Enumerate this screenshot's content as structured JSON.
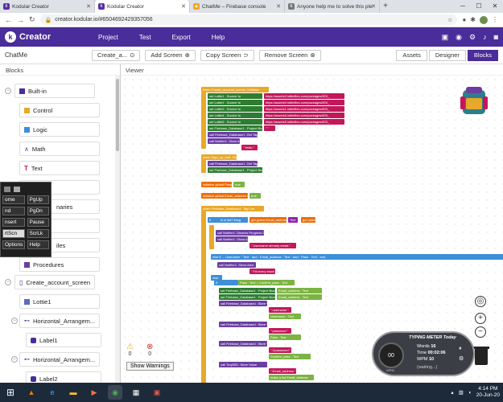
{
  "browser": {
    "tabs": [
      {
        "title": "Kodular Creator",
        "icon": "kodular-favicon",
        "active": false
      },
      {
        "title": "Kodular Creator",
        "icon": "kodular-favicon",
        "active": true
      },
      {
        "title": "ChatMe – Firebase console",
        "icon": "firebase-favicon",
        "active": false
      },
      {
        "title": "Anyone help me to solve this ple",
        "icon": "forum-favicon",
        "active": false
      }
    ],
    "url": "creator.kodular.io/#6504692429357056"
  },
  "app": {
    "logo_text": "Creator",
    "menu": [
      "Project",
      "Test",
      "Export",
      "Help"
    ]
  },
  "toolbar": {
    "project_name": "ChatMe",
    "screen_select": "Create_a...",
    "add_screen": "Add Screen",
    "copy_screen": "Copy Screen",
    "remove_screen": "Remove Screen",
    "modes": [
      "Assets",
      "Designer",
      "Blocks"
    ],
    "active_mode": "Blocks"
  },
  "blocks_panel": {
    "title": "Blocks",
    "builtin_label": "Built-in",
    "builtin": [
      {
        "label": "Control",
        "icon": "control-icon",
        "color": "#e8a82a"
      },
      {
        "label": "Logic",
        "icon": "logic-icon",
        "color": "#3e8fd8"
      },
      {
        "label": "Math",
        "icon": "math-icon",
        "color": "#3f51b5"
      },
      {
        "label": "Text",
        "icon": "text-icon",
        "color": "#c2185b"
      }
    ],
    "partial_items": [
      "naries",
      "iles"
    ],
    "procedures_label": "Procedures",
    "screen_label": "Create_account_screen",
    "components": [
      {
        "label": "Lottie1",
        "indent": 2
      },
      {
        "label": "Horizontal_Arrangem...",
        "indent": 1
      },
      {
        "label": "Label1",
        "indent": 2
      },
      {
        "label": "Horizontal_Arrangem...",
        "indent": 1
      },
      {
        "label": "Label2",
        "indent": 2
      }
    ]
  },
  "viewer": {
    "title": "Viewer",
    "warnings_count": "0",
    "errors_count": "0",
    "show_warnings": "Show Warnings"
  },
  "keyboard": {
    "rows": [
      [
        "Home",
        "PgUp"
      ],
      [
        "End",
        "PgDn"
      ],
      [
        "Insert",
        "Pause"
      ],
      [
        "PrtScn",
        "ScrLk"
      ],
      [
        "Options",
        "Help"
      ]
    ],
    "partial_rows": [
      [
        "ome",
        "PgUp"
      ],
      [
        "nd",
        "PgDn"
      ],
      [
        "nsert",
        "Pause"
      ],
      [
        "rtScn",
        "ScrLk"
      ],
      [
        "Options",
        "Help"
      ]
    ]
  },
  "typing_meter": {
    "title": "TYPING METER Today",
    "words_label": "Words",
    "words": "16",
    "time_label": "Time",
    "time": "00:02:06",
    "wpm_label": "WPM",
    "wpm": "10",
    "status": "(waiting...)",
    "gauge_value": "00",
    "gauge_unit": "WPM"
  },
  "taskbar": {
    "time": "4:14 PM",
    "date": "20-Jun-20"
  }
}
